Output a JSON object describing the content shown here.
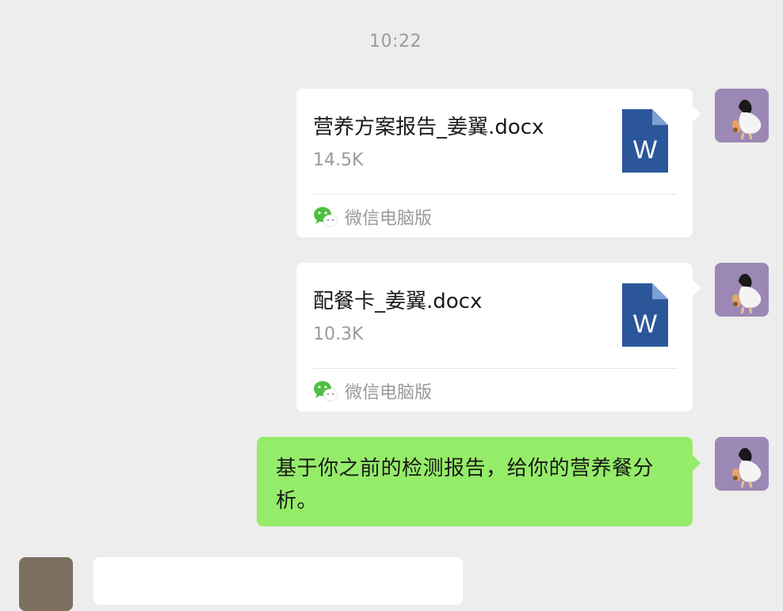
{
  "chat": {
    "timestamp": "10:22",
    "messages": [
      {
        "type": "file",
        "file_name": "营养方案报告_姜翼.docx",
        "file_size": "14.5K",
        "file_icon": "word-doc-icon",
        "file_icon_letter": "W",
        "source_icon": "wechat-icon",
        "source_label": "微信电脑版"
      },
      {
        "type": "file",
        "file_name": "配餐卡_姜翼.docx",
        "file_size": "10.3K",
        "file_icon": "word-doc-icon",
        "file_icon_letter": "W",
        "source_icon": "wechat-icon",
        "source_label": "微信电脑版"
      },
      {
        "type": "text",
        "text": "基于你之前的检测报告，给你的营养餐分析。"
      }
    ]
  },
  "colors": {
    "background": "#ededed",
    "sent_bubble": "#95ec69",
    "file_bubble": "#ffffff",
    "word_blue": "#2b579a",
    "wechat_green": "#4cbf3f",
    "secondary_text": "#9a9a9a"
  }
}
